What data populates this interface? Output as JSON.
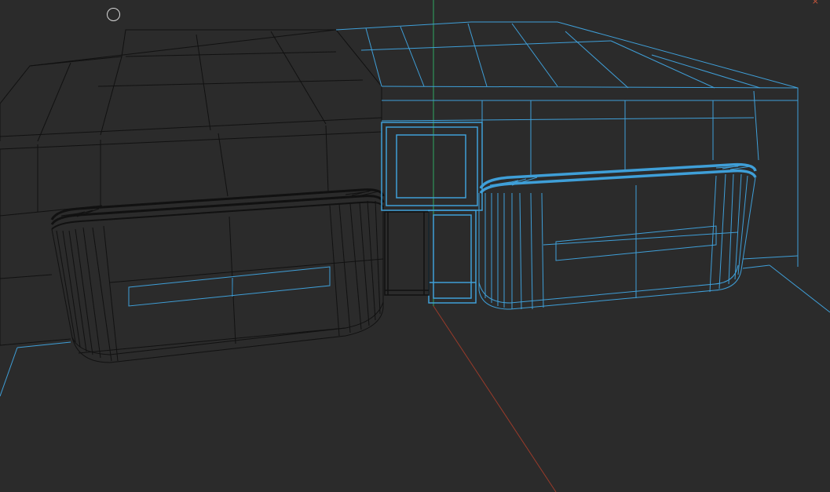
{
  "viewport": {
    "mode": "wireframe",
    "background_color": "#2b2b2b",
    "unselected_wire_color": "#111111",
    "selected_wire_color": "#3f9fd8",
    "axis_y_color": "#2fa760",
    "axis_x_color": "#9a3b2a"
  },
  "cursor": {
    "icon": "circle-cursor-icon"
  },
  "corner_marker": {
    "icon": "close-x-icon",
    "glyph": "×"
  },
  "objects": [
    {
      "name": "left-reception-counter",
      "selected": false
    },
    {
      "name": "left-wall-canopy",
      "selected": false
    },
    {
      "name": "center-door-frame",
      "selected": true
    },
    {
      "name": "right-reception-counter",
      "selected": true
    },
    {
      "name": "right-wall-canopy",
      "selected": true
    }
  ]
}
